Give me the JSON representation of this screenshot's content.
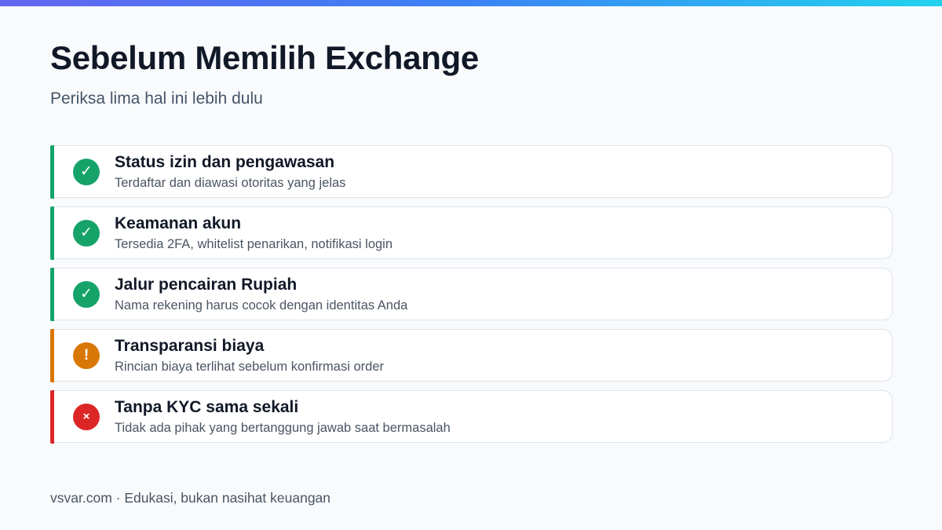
{
  "header": {
    "title": "Sebelum Memilih Exchange",
    "subtitle": "Periksa lima hal ini lebih dulu"
  },
  "items": [
    {
      "title": "Status izin dan pengawasan",
      "description": "Terdaftar dan diawasi otoritas yang jelas",
      "status": "ok",
      "icon": "check-icon",
      "glyph": "✓",
      "color": "#16a36a"
    },
    {
      "title": "Keamanan akun",
      "description": "Tersedia 2FA, whitelist penarikan, notifikasi login",
      "status": "ok",
      "icon": "check-icon",
      "glyph": "✓",
      "color": "#16a36a"
    },
    {
      "title": "Jalur pencairan Rupiah",
      "description": "Nama rekening harus cocok dengan identitas Anda",
      "status": "ok",
      "icon": "check-icon",
      "glyph": "✓",
      "color": "#16a36a"
    },
    {
      "title": "Transparansi biaya",
      "description": "Rincian biaya terlihat sebelum konfirmasi order",
      "status": "warning",
      "icon": "exclamation-icon",
      "glyph": "!",
      "color": "#d97706"
    },
    {
      "title": "Tanpa KYC sama sekali",
      "description": "Tidak ada pihak yang bertanggung jawab saat bermasalah",
      "status": "danger",
      "icon": "cross-icon",
      "glyph": "×",
      "color": "#dc2626"
    }
  ],
  "footer": {
    "text": "vsvar.com · Edukasi, bukan nasihat keuangan"
  },
  "colors": {
    "title": "#111827",
    "subtitle": "#475569",
    "background": "#f8fafc",
    "ok": "#16a36a",
    "warning": "#d97706",
    "danger": "#dc2626"
  }
}
